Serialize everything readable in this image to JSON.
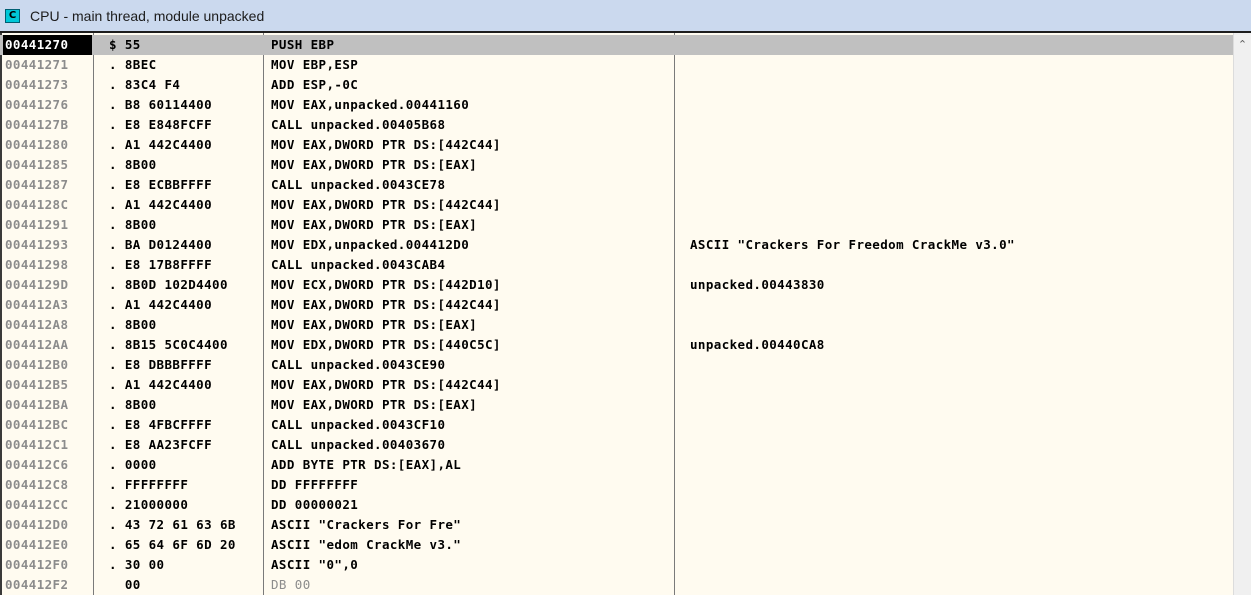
{
  "window": {
    "title": "CPU - main thread, module unpacked",
    "icon_letter": "C",
    "icon_name": "cpu-window-icon",
    "scroll_up_icon": "chevron-up-icon"
  },
  "colors": {
    "title_bar": "#cbd9ee",
    "pane_background": "#fffbf0",
    "selected_row": "#c0c0c0",
    "address_text": "#8c8c8c"
  },
  "rows": [
    {
      "addr": "00441270",
      "hex": "$ 55",
      "dis": "PUSH EBP",
      "cmt": "",
      "selected": true
    },
    {
      "addr": "00441271",
      "hex": ". 8BEC",
      "dis": "MOV EBP,ESP",
      "cmt": ""
    },
    {
      "addr": "00441273",
      "hex": ". 83C4 F4",
      "dis": "ADD ESP,-0C",
      "cmt": ""
    },
    {
      "addr": "00441276",
      "hex": ". B8 60114400",
      "dis": "MOV EAX,unpacked.00441160",
      "cmt": ""
    },
    {
      "addr": "0044127B",
      "hex": ". E8 E848FCFF",
      "dis": "CALL unpacked.00405B68",
      "cmt": ""
    },
    {
      "addr": "00441280",
      "hex": ". A1 442C4400",
      "dis": "MOV EAX,DWORD PTR DS:[442C44]",
      "cmt": ""
    },
    {
      "addr": "00441285",
      "hex": ". 8B00",
      "dis": "MOV EAX,DWORD PTR DS:[EAX]",
      "cmt": ""
    },
    {
      "addr": "00441287",
      "hex": ". E8 ECBBFFFF",
      "dis": "CALL unpacked.0043CE78",
      "cmt": ""
    },
    {
      "addr": "0044128C",
      "hex": ". A1 442C4400",
      "dis": "MOV EAX,DWORD PTR DS:[442C44]",
      "cmt": ""
    },
    {
      "addr": "00441291",
      "hex": ". 8B00",
      "dis": "MOV EAX,DWORD PTR DS:[EAX]",
      "cmt": ""
    },
    {
      "addr": "00441293",
      "hex": ". BA D0124400",
      "dis": "MOV EDX,unpacked.004412D0",
      "cmt": "ASCII \"Crackers For Freedom CrackMe v3.0\""
    },
    {
      "addr": "00441298",
      "hex": ". E8 17B8FFFF",
      "dis": "CALL unpacked.0043CAB4",
      "cmt": ""
    },
    {
      "addr": "0044129D",
      "hex": ". 8B0D 102D4400",
      "dis": "MOV ECX,DWORD PTR DS:[442D10]",
      "cmt": "unpacked.00443830"
    },
    {
      "addr": "004412A3",
      "hex": ". A1 442C4400",
      "dis": "MOV EAX,DWORD PTR DS:[442C44]",
      "cmt": ""
    },
    {
      "addr": "004412A8",
      "hex": ". 8B00",
      "dis": "MOV EAX,DWORD PTR DS:[EAX]",
      "cmt": ""
    },
    {
      "addr": "004412AA",
      "hex": ". 8B15 5C0C4400",
      "dis": "MOV EDX,DWORD PTR DS:[440C5C]",
      "cmt": "unpacked.00440CA8"
    },
    {
      "addr": "004412B0",
      "hex": ". E8 DBBBFFFF",
      "dis": "CALL unpacked.0043CE90",
      "cmt": ""
    },
    {
      "addr": "004412B5",
      "hex": ". A1 442C4400",
      "dis": "MOV EAX,DWORD PTR DS:[442C44]",
      "cmt": ""
    },
    {
      "addr": "004412BA",
      "hex": ". 8B00",
      "dis": "MOV EAX,DWORD PTR DS:[EAX]",
      "cmt": ""
    },
    {
      "addr": "004412BC",
      "hex": ". E8 4FBCFFFF",
      "dis": "CALL unpacked.0043CF10",
      "cmt": ""
    },
    {
      "addr": "004412C1",
      "hex": ". E8 AA23FCFF",
      "dis": "CALL unpacked.00403670",
      "cmt": ""
    },
    {
      "addr": "004412C6",
      "hex": ". 0000",
      "dis": "ADD BYTE PTR DS:[EAX],AL",
      "cmt": ""
    },
    {
      "addr": "004412C8",
      "hex": ". FFFFFFFF",
      "dis": "DD FFFFFFFF",
      "cmt": ""
    },
    {
      "addr": "004412CC",
      "hex": ". 21000000",
      "dis": "DD 00000021",
      "cmt": ""
    },
    {
      "addr": "004412D0",
      "hex": ". 43 72 61 63 6B",
      "dis": "ASCII \"Crackers For Fre\"",
      "cmt": ""
    },
    {
      "addr": "004412E0",
      "hex": ". 65 64 6F 6D 20",
      "dis": "ASCII \"edom CrackMe v3.\"",
      "cmt": ""
    },
    {
      "addr": "004412F0",
      "hex": ". 30 00",
      "dis": "ASCII \"0\",0",
      "cmt": ""
    },
    {
      "addr": "004412F2",
      "hex": "  00",
      "dis": "DB 00",
      "cmt": "",
      "grey": true
    }
  ]
}
